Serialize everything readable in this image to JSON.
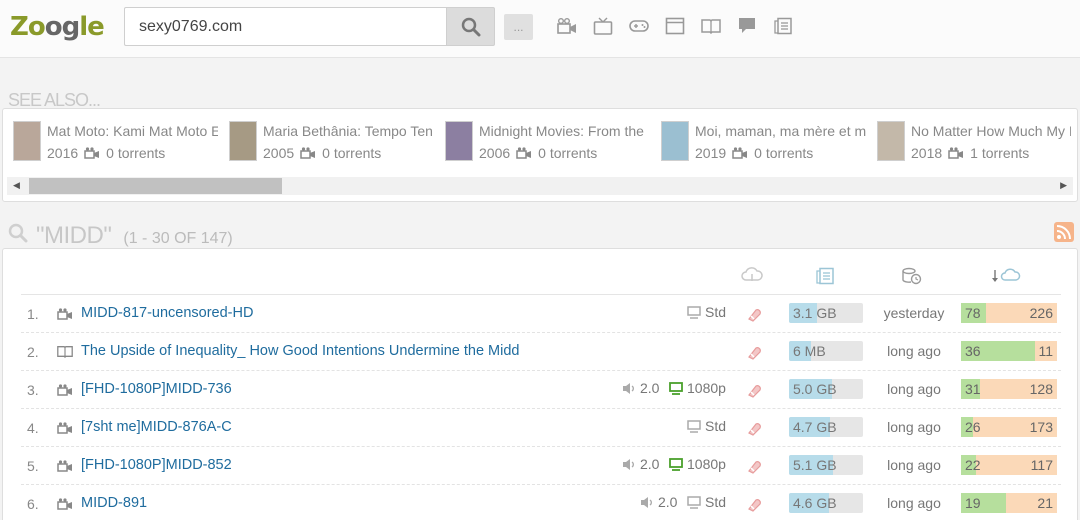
{
  "header": {
    "logo_pre": "Zo",
    "logo_mid": "og",
    "logo_post": "le",
    "search_value": "sexy0769.com",
    "more_label": "...",
    "category_icons": [
      "movie-icon",
      "tv-icon",
      "game-icon",
      "app-icon",
      "book-icon",
      "comic-icon",
      "other-icon"
    ]
  },
  "see_also": {
    "title": "SEE ALSO...",
    "items": [
      {
        "title": "Mat Moto: Kami Mat Moto E",
        "year": "2016",
        "torrents": "0 torrents",
        "thumb_color": "#b9a79a"
      },
      {
        "title": "Maria Bethânia: Tempo Ten",
        "year": "2005",
        "torrents": "0 torrents",
        "thumb_color": "#a69a84"
      },
      {
        "title": "Midnight Movies: From the",
        "year": "2006",
        "torrents": "0 torrents",
        "thumb_color": "#8c7fa1"
      },
      {
        "title": "Moi, maman, ma mère et m",
        "year": "2019",
        "torrents": "0 torrents",
        "thumb_color": "#9bbfd1"
      },
      {
        "title": "No Matter How Much My I",
        "year": "2018",
        "torrents": "1 torrents",
        "thumb_color": "#c3b8a9"
      }
    ]
  },
  "results": {
    "query": "\"MIDD\"",
    "count": "(1 - 30 OF 147)",
    "rows": [
      {
        "num": "1.",
        "cat": "movie",
        "title": "MIDD-817-uncensored-HD",
        "audio": "",
        "quality": "Std",
        "size": "3.1 GB",
        "size_pct": 0.38,
        "date": "yesterday",
        "seeds": "78",
        "leech": "226",
        "seed_pct": 0.26
      },
      {
        "num": "2.",
        "cat": "book",
        "title": "The Upside of Inequality_ How Good Intentions Undermine the Midd",
        "audio": "",
        "quality": "",
        "size": "6 MB",
        "size_pct": 0.3,
        "date": "long ago",
        "seeds": "36",
        "leech": "11",
        "seed_pct": 0.77
      },
      {
        "num": "3.",
        "cat": "movie",
        "title": "[FHD-1080P]MIDD-736",
        "audio": "2.0",
        "quality": "1080p",
        "size": "5.0 GB",
        "size_pct": 0.58,
        "date": "long ago",
        "seeds": "31",
        "leech": "128",
        "seed_pct": 0.2
      },
      {
        "num": "4.",
        "cat": "movie",
        "title": "[7sht me]MIDD-876A-C",
        "audio": "",
        "quality": "Std",
        "size": "4.7 GB",
        "size_pct": 0.55,
        "date": "long ago",
        "seeds": "26",
        "leech": "173",
        "seed_pct": 0.13
      },
      {
        "num": "5.",
        "cat": "movie",
        "title": "[FHD-1080P]MIDD-852",
        "audio": "2.0",
        "quality": "1080p",
        "size": "5.1 GB",
        "size_pct": 0.6,
        "date": "long ago",
        "seeds": "22",
        "leech": "117",
        "seed_pct": 0.16
      },
      {
        "num": "6.",
        "cat": "movie",
        "title": "MIDD-891",
        "audio": "2.0",
        "quality": "Std",
        "size": "4.6 GB",
        "size_pct": 0.54,
        "date": "long ago",
        "seeds": "19",
        "leech": "21",
        "seed_pct": 0.47
      }
    ]
  },
  "colors": {
    "link": "#1f6c9e",
    "seed": "#b6df9d",
    "leech": "#fbd9b8",
    "size": "#b7dcea",
    "hd": "#4aa02c"
  }
}
